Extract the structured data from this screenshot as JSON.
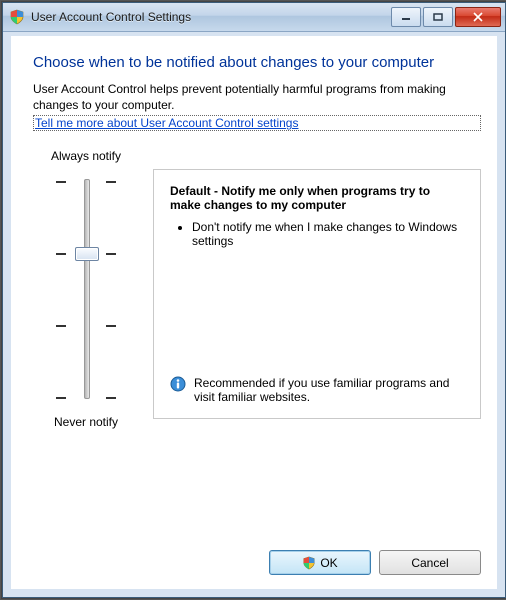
{
  "window": {
    "title": "User Account Control Settings"
  },
  "content": {
    "heading": "Choose when to be notified about changes to your computer",
    "description": "User Account Control helps prevent potentially harmful programs from making changes to your computer.",
    "link": "Tell me more about User Account Control settings"
  },
  "slider": {
    "top_label": "Always notify",
    "bottom_label": "Never notify",
    "levels": 4,
    "selected_index": 1
  },
  "option": {
    "title": "Default - Notify me only when programs try to make changes to my computer",
    "bullet1": "Don't notify me when I make changes to Windows settings",
    "recommendation": "Recommended if you use familiar programs and visit familiar websites."
  },
  "buttons": {
    "ok": "OK",
    "cancel": "Cancel"
  }
}
